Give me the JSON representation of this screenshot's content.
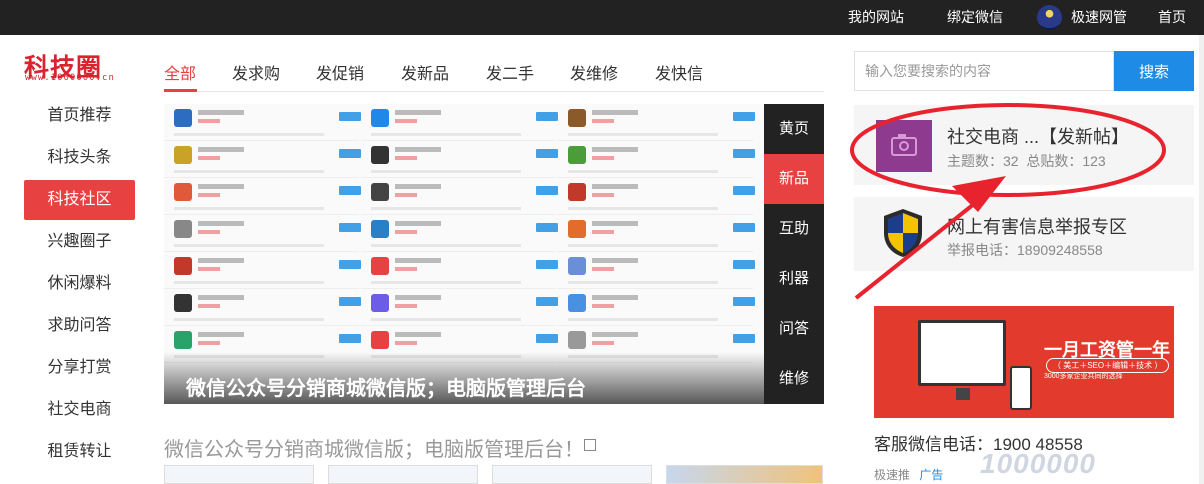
{
  "topbar": {
    "my_site": "我的网站",
    "bind_wechat": "绑定微信",
    "username": "极速网管",
    "home": "首页"
  },
  "logo": {
    "name": "科技圈",
    "domain": "www.1000000.cn"
  },
  "sidebar": {
    "items": [
      {
        "label": "首页推荐"
      },
      {
        "label": "科技头条"
      },
      {
        "label": "科技社区",
        "active": true
      },
      {
        "label": "兴趣圈子"
      },
      {
        "label": "休闲爆料"
      },
      {
        "label": "求助问答"
      },
      {
        "label": "分享打赏"
      },
      {
        "label": "社交电商"
      },
      {
        "label": "租赁转让"
      }
    ]
  },
  "tabs": [
    {
      "label": "全部",
      "active": true
    },
    {
      "label": "发求购"
    },
    {
      "label": "发促销"
    },
    {
      "label": "发新品"
    },
    {
      "label": "发二手"
    },
    {
      "label": "发维修"
    },
    {
      "label": "发快信"
    }
  ],
  "slider": {
    "caption": "微信公众号分销商城微信版；电脑版管理后台",
    "tabs": [
      {
        "label": "黄页"
      },
      {
        "label": "新品",
        "active": true
      },
      {
        "label": "互助"
      },
      {
        "label": "利器"
      },
      {
        "label": "问答"
      },
      {
        "label": "维修"
      }
    ]
  },
  "post": {
    "title": "微信公众号分销商城微信版；电脑版管理后台！"
  },
  "search": {
    "placeholder": "输入您要搜索的内容",
    "button": "搜索"
  },
  "group_card": {
    "title": "社交电商 ...【发新帖】",
    "topics_label": "主题数：32",
    "posts_label": "总贴数：123"
  },
  "report_card": {
    "title": "网上有害信息举报专区",
    "phone": "举报电话：18909248558"
  },
  "ad": {
    "headline": "一月工资管一年",
    "tagline": "（ 美工＋SEO＋编辑＋技术 ）",
    "note": "3000多家企业共同的选择"
  },
  "service": {
    "label": "客服微信电话：1900 48558",
    "author": "极速推",
    "ad_tag": "广告"
  },
  "watermark": "1000000",
  "colors": {
    "accent": "#e84142",
    "link": "#1e8ce6",
    "annotation": "#e8232e"
  }
}
